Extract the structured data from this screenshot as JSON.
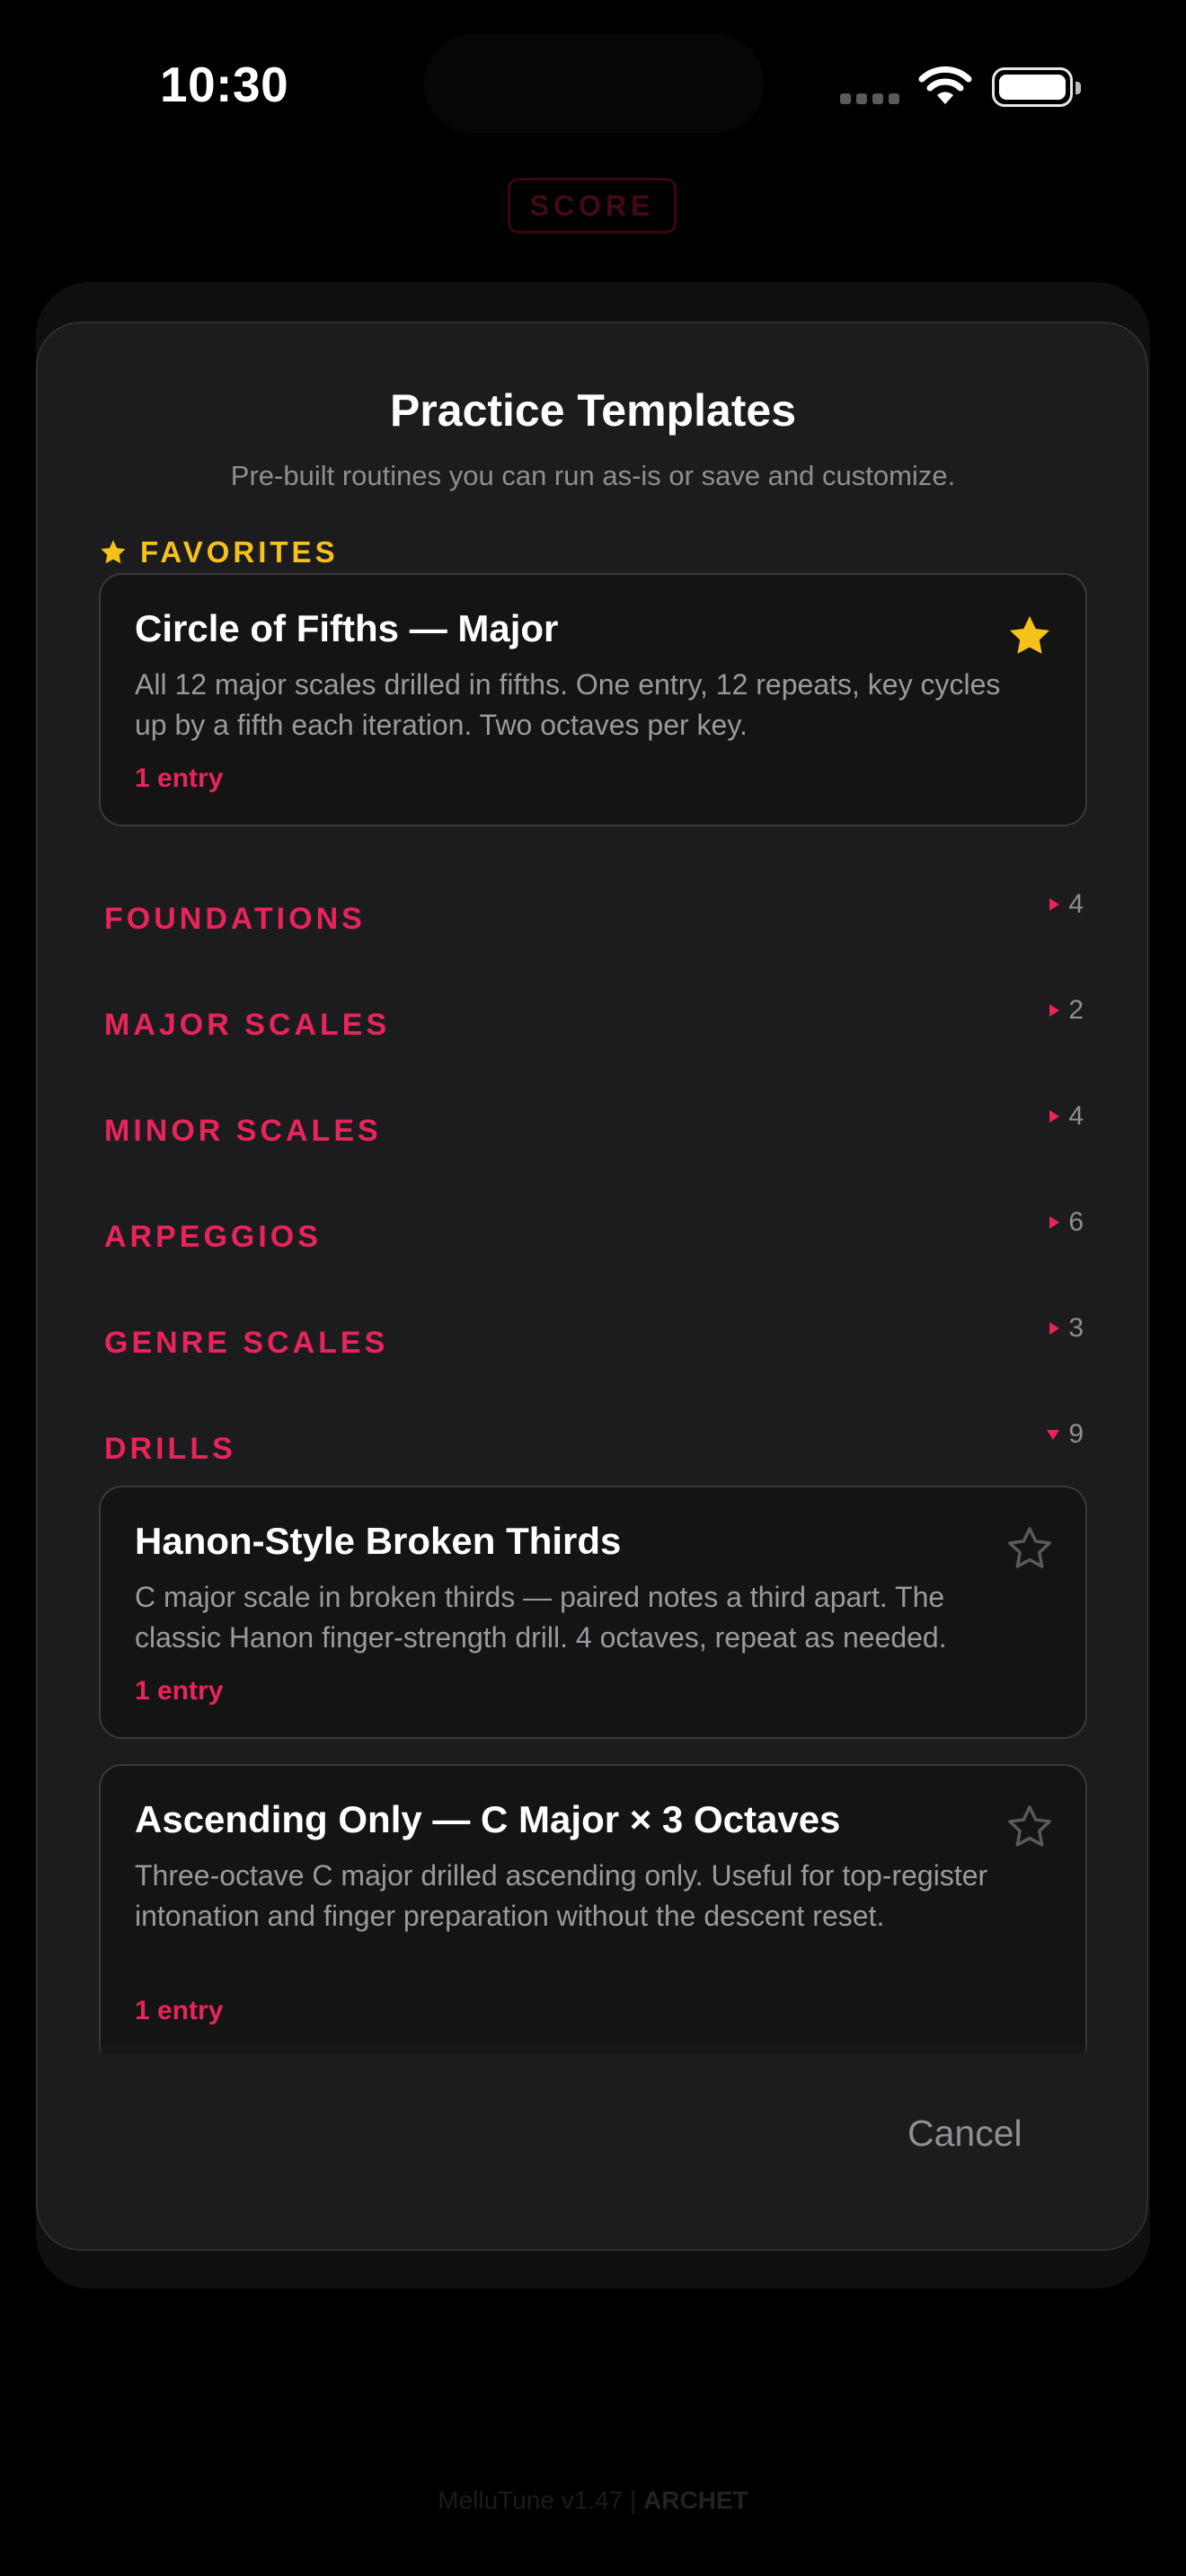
{
  "status_bar": {
    "time": "10:30"
  },
  "background": {
    "score_label": "SCORE",
    "footer_app": "MelluTune v1.47 |",
    "footer_brand": "ARCHET"
  },
  "sheet": {
    "title": "Practice Templates",
    "subtitle": "Pre-built routines you can run as-is or save and customize.",
    "favorites_label": "FAVORITES",
    "favorite_card": {
      "title": "Circle of Fifths — Major",
      "description": "All 12 major scales drilled in fifths. One entry, 12 repeats, key cycles up by a fifth each iteration. Two octaves per key.",
      "count": "1 entry"
    },
    "sections": [
      {
        "label": "FOUNDATIONS",
        "count": "4"
      },
      {
        "label": "MAJOR SCALES",
        "count": "2"
      },
      {
        "label": "MINOR SCALES",
        "count": "4"
      },
      {
        "label": "ARPEGGIOS",
        "count": "6"
      },
      {
        "label": "GENRE SCALES",
        "count": "3"
      },
      {
        "label": "DRILLS",
        "count": "9"
      }
    ],
    "drills": [
      {
        "title": "Hanon-Style Broken Thirds",
        "description": "C major scale in broken thirds — paired notes a third apart. The classic Hanon finger-strength drill. 4 octaves, repeat as needed.",
        "count": "1 entry"
      },
      {
        "title": "Ascending Only — C Major × 3 Octaves",
        "description": "Three-octave C major drilled ascending only. Useful for top-register intonation and finger preparation without the descent reset.",
        "count": "1 entry"
      }
    ],
    "cancel_label": "Cancel"
  },
  "colors": {
    "accent": "#e8245b",
    "favorite": "#f5c21b",
    "sheet_bg": "#1c1c1e",
    "card_bg": "#141415"
  }
}
